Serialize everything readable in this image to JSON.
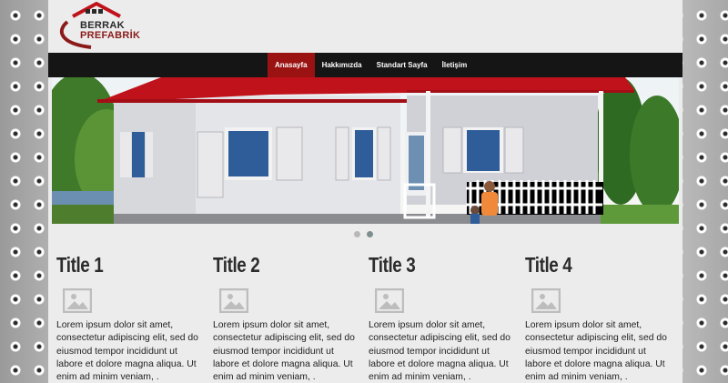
{
  "logo": {
    "line1": "BERRAK",
    "line2": "PREFABRİK"
  },
  "nav": {
    "items": [
      {
        "label": "Anasayfa",
        "active": true
      },
      {
        "label": "Hakkımızda",
        "active": false
      },
      {
        "label": "Standart Sayfa",
        "active": false
      },
      {
        "label": "İletişim",
        "active": false
      }
    ]
  },
  "slider": {
    "slides": 2,
    "active_slide": 2
  },
  "columns": [
    {
      "title": "Title 1",
      "icon": "image-placeholder-icon",
      "text": "Lorem ipsum dolor sit amet, consectetur adipiscing elit, sed do eiusmod tempor incididunt ut labore et dolore magna aliqua. Ut enim ad minim veniam, ."
    },
    {
      "title": "Title 2",
      "icon": "image-placeholder-icon",
      "text": "Lorem ipsum dolor sit amet, consectetur adipiscing elit, sed do eiusmod tempor incididunt ut labore et dolore magna aliqua. Ut enim ad minim veniam, ."
    },
    {
      "title": "Title 3",
      "icon": "image-placeholder-icon",
      "text": "Lorem ipsum dolor sit amet, consectetur adipiscing elit, sed do eiusmod tempor incididunt ut labore et dolore magna aliqua. Ut enim ad minim veniam, ."
    },
    {
      "title": "Title 4",
      "icon": "image-placeholder-icon",
      "text": "Lorem ipsum dolor sit amet, consectetur adipiscing elit, sed do eiusmod tempor incididunt ut labore et dolore magna aliqua. Ut enim ad minim veniam, ."
    }
  ],
  "colors": {
    "nav_bg": "#151515",
    "nav_active": "#9b1212",
    "roof": "#c0121b",
    "page_bg": "#ececec"
  }
}
